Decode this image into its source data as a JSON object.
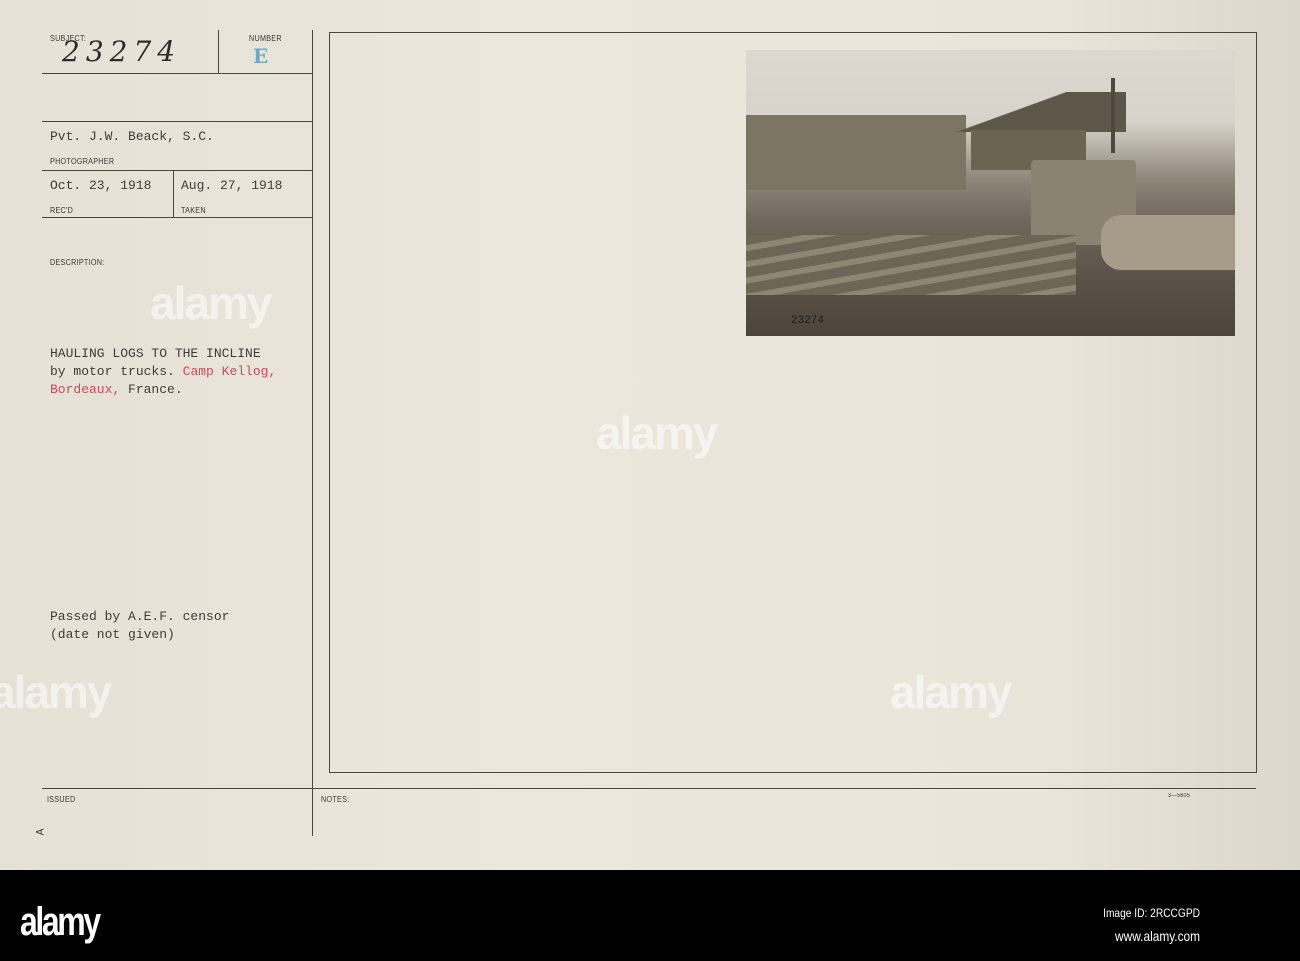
{
  "card": {
    "subject_label": "SUBJECT:",
    "subject_value": "23274",
    "number_label": "NUMBER",
    "number_value": "E",
    "photographer_value": "Pvt. J.W. Beack, S.C.",
    "photographer_label": "PHOTOGRAPHER",
    "received_value": "Oct. 23, 1918",
    "received_label": "REC'D",
    "taken_value": "Aug. 27, 1918",
    "taken_label": "TAKEN",
    "description_label": "DESCRIPTION:",
    "description_lines": [
      "HAULING LOGS TO THE INCLINE",
      "by motor trucks.",
      "Camp Kellog,",
      "Bordeaux,",
      "France."
    ],
    "censor_lines": [
      "Passed by A.E.F. censor",
      "(date not given)"
    ],
    "issued_label": "ISSUED",
    "issued_mark": "A",
    "notes_label": "NOTES:",
    "form_number": "3—5605",
    "photo_caption_number": "23274",
    "accent_red": "#d04a55",
    "stamp_blue": "#6ea8c8"
  },
  "watermark": "alamy",
  "footer": {
    "logo": "alamy",
    "image_id": "Image ID: 2RCCGPD",
    "url": "www.alamy.com"
  }
}
